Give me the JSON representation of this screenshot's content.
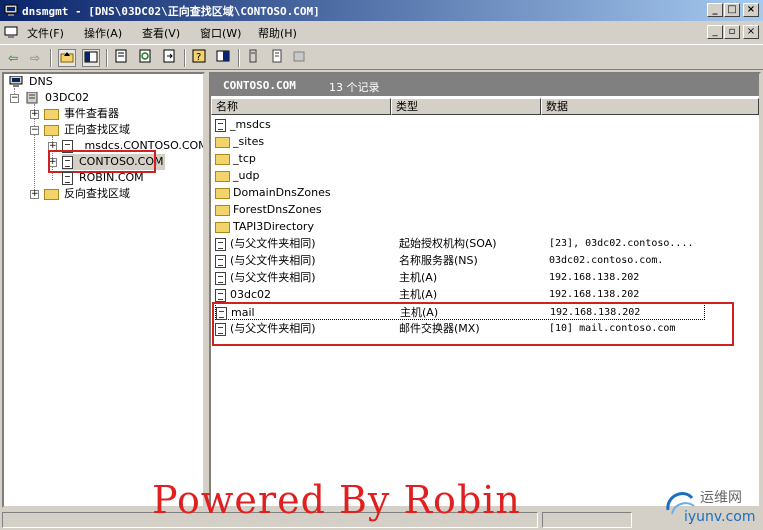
{
  "window": {
    "title": "dnsmgmt - [DNS\\03DC02\\正向查找区域\\CONTOSO.COM]",
    "minimize": "_",
    "maximize": "□",
    "close": "×"
  },
  "menu": {
    "items": [
      "文件(F)",
      "操作(A)",
      "查看(V)",
      "窗口(W)",
      "帮助(H)"
    ]
  },
  "toolbar": {
    "back": "⇦",
    "forward": "⇨"
  },
  "tree": {
    "root": "DNS",
    "server": "03DC02",
    "event_viewer": "事件查看器",
    "forward_zones": "正向查找区域",
    "msdcs_zone": "_msdcs.CONTOSO.COM",
    "contoso_zone": "CONTOSO.COM",
    "robin_zone": "ROBIN.COM",
    "reverse_zones": "反向查找区域"
  },
  "right_pane": {
    "zone_name": "CONTOSO.COM",
    "record_count": "13 个记录",
    "columns": {
      "name": "名称",
      "type": "类型",
      "data": "数据"
    },
    "rows": [
      {
        "name": "_msdcs",
        "type": "",
        "data": "",
        "icon": "folder-doc"
      },
      {
        "name": "_sites",
        "type": "",
        "data": "",
        "icon": "folder"
      },
      {
        "name": "_tcp",
        "type": "",
        "data": "",
        "icon": "folder"
      },
      {
        "name": "_udp",
        "type": "",
        "data": "",
        "icon": "folder"
      },
      {
        "name": "DomainDnsZones",
        "type": "",
        "data": "",
        "icon": "folder"
      },
      {
        "name": "ForestDnsZones",
        "type": "",
        "data": "",
        "icon": "folder"
      },
      {
        "name": "TAPI3Directory",
        "type": "",
        "data": "",
        "icon": "folder"
      },
      {
        "name": "(与父文件夹相同)",
        "type": "起始授权机构(SOA)",
        "data": "[23], 03dc02.contoso....",
        "icon": "record"
      },
      {
        "name": "(与父文件夹相同)",
        "type": "名称服务器(NS)",
        "data": "03dc02.contoso.com.",
        "icon": "record"
      },
      {
        "name": "(与父文件夹相同)",
        "type": "主机(A)",
        "data": "192.168.138.202",
        "icon": "record"
      },
      {
        "name": "03dc02",
        "type": "主机(A)",
        "data": "192.168.138.202",
        "icon": "record"
      },
      {
        "name": "mail",
        "type": "主机(A)",
        "data": "192.168.138.202",
        "icon": "record"
      },
      {
        "name": "(与父文件夹相同)",
        "type": "邮件交换器(MX)",
        "data": "[10]  mail.contoso.com",
        "icon": "record"
      }
    ]
  },
  "watermark": "Powered By Robin",
  "logo": {
    "name": "运维网",
    "url": "iyunv.com"
  },
  "colors": {
    "highlight_box": "#d02020",
    "title_gradient_start": "#0a246a",
    "title_gradient_end": "#a6caf0"
  }
}
